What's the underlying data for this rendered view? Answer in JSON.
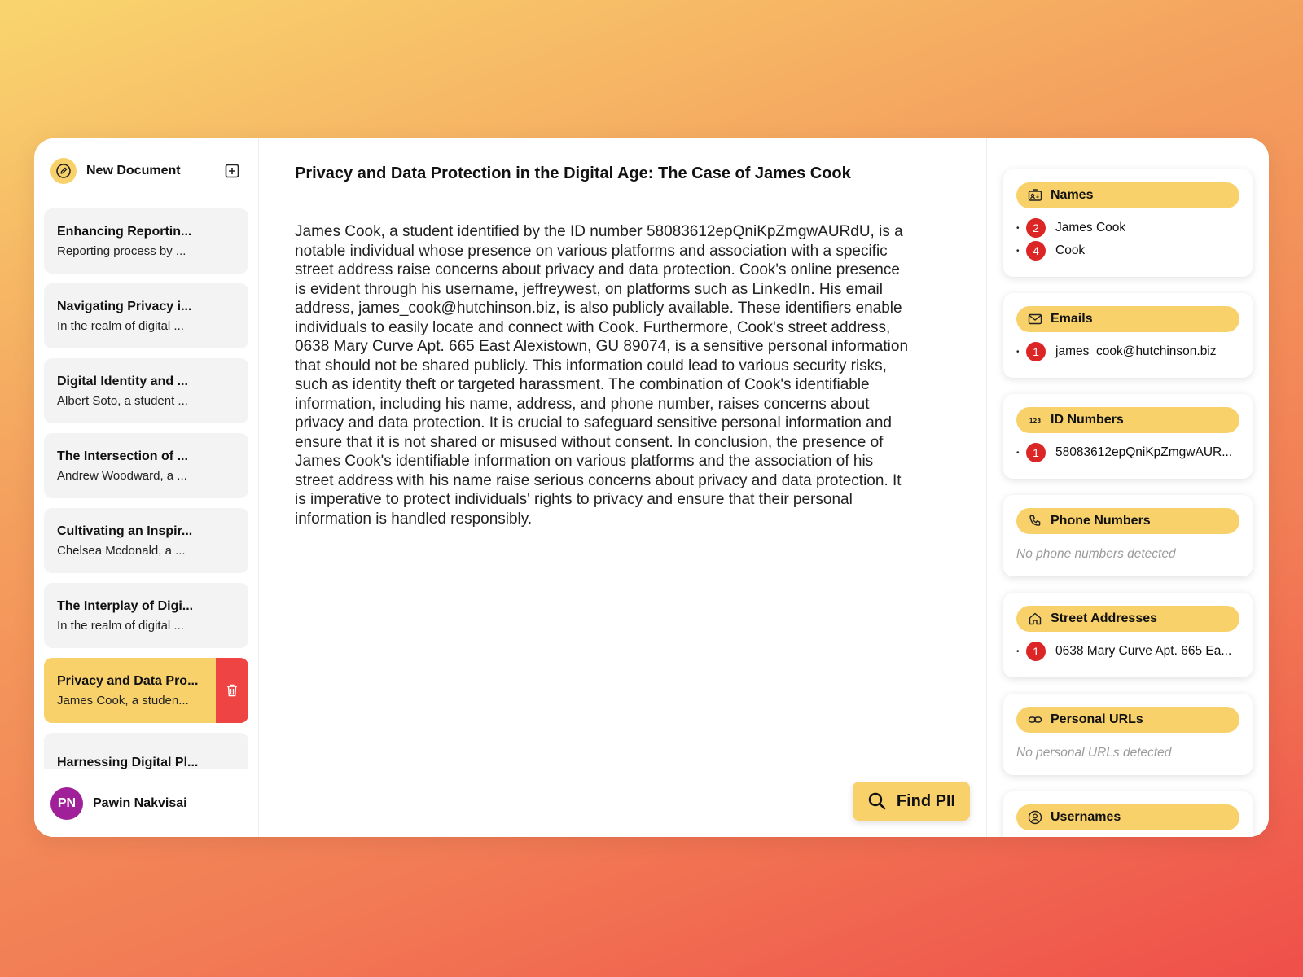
{
  "sidebar": {
    "new_document_label": "New Document",
    "documents": [
      {
        "title": "Enhancing Reportin...",
        "snippet": "Reporting process by ..."
      },
      {
        "title": "Navigating Privacy i...",
        "snippet": "In the realm of digital ..."
      },
      {
        "title": "Digital Identity and ...",
        "snippet": "Albert Soto, a student ..."
      },
      {
        "title": "The Intersection of ...",
        "snippet": "Andrew Woodward, a ..."
      },
      {
        "title": "Cultivating an Inspir...",
        "snippet": "Chelsea Mcdonald, a ..."
      },
      {
        "title": "The Interplay of Digi...",
        "snippet": "In the realm of digital ..."
      },
      {
        "title": "Privacy and Data Pro...",
        "snippet": "James Cook, a studen..."
      },
      {
        "title": "Harnessing Digital Pl...",
        "snippet": ""
      }
    ],
    "active_index": 6,
    "user": {
      "initials": "PN",
      "name": "Pawin Nakvisai"
    }
  },
  "main": {
    "title": "Privacy and Data Protection in the Digital Age: The Case of James Cook",
    "body": "James Cook, a student identified by the ID number 58083612epQniKpZmgwAURdU, is a notable individual whose presence on various platforms and association with a specific street address raise concerns about privacy and data protection. Cook's online presence is evident through his username, jeffreywest, on platforms such as LinkedIn. His email address, james_cook@hutchinson.biz, is also publicly available. These identifiers enable individuals to easily locate and connect with Cook. Furthermore, Cook's street address, 0638 Mary Curve Apt. 665 East Alexistown, GU 89074, is a sensitive personal information that should not be shared publicly. This information could lead to various security risks, such as identity theft or targeted harassment. The combination of Cook's identifiable information, including his name, address, and phone number, raises concerns about privacy and data protection. It is crucial to safeguard sensitive personal information and ensure that it is not shared or misused without consent. In conclusion, the presence of James Cook's identifiable information on various platforms and the association of his street address with his name raise serious concerns about privacy and data protection. It is imperative to protect individuals' rights to privacy and ensure that their personal information is handled responsibly.",
    "find_button_label": "Find PII"
  },
  "pii": {
    "names": {
      "title": "Names",
      "icon": "id-card-icon",
      "items": [
        {
          "count": "2",
          "text": "James Cook"
        },
        {
          "count": "4",
          "text": "Cook"
        }
      ]
    },
    "emails": {
      "title": "Emails",
      "icon": "mail-icon",
      "items": [
        {
          "count": "1",
          "text": "james_cook@hutchinson.biz"
        }
      ]
    },
    "ids": {
      "title": "ID Numbers",
      "icon": "number-icon",
      "items": [
        {
          "count": "1",
          "text": "58083612epQniKpZmgwAUR..."
        }
      ]
    },
    "phones": {
      "title": "Phone Numbers",
      "icon": "phone-icon",
      "empty": "No phone numbers detected"
    },
    "addresses": {
      "title": "Street Addresses",
      "icon": "home-icon",
      "items": [
        {
          "count": "1",
          "text": "0638 Mary Curve Apt. 665 Ea..."
        }
      ]
    },
    "urls": {
      "title": "Personal URLs",
      "icon": "link-icon",
      "empty": "No personal URLs detected"
    },
    "usernames": {
      "title": "Usernames",
      "icon": "user-circle-icon"
    }
  },
  "colors": {
    "accent": "#f8d16a",
    "badge": "#dc2626",
    "delete": "#ef4444",
    "avatar": "#a0209a"
  }
}
